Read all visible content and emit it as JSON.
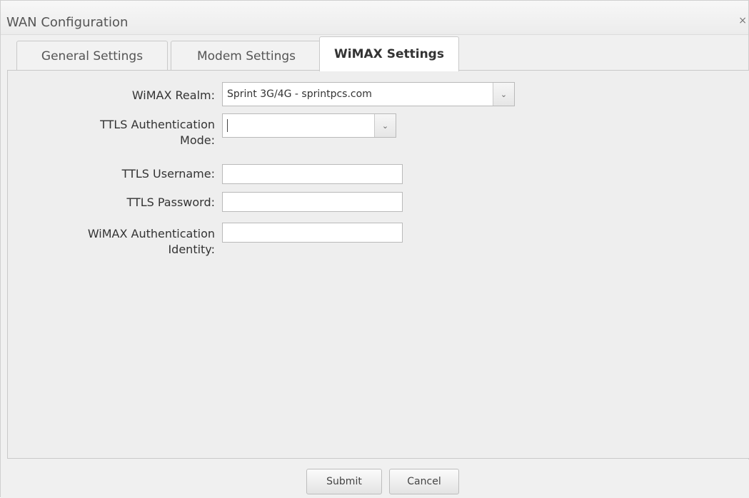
{
  "window": {
    "title": "WAN Configuration",
    "close_label": "×"
  },
  "tabs": [
    {
      "label": "General Settings",
      "active": false
    },
    {
      "label": "Modem Settings",
      "active": false
    },
    {
      "label": "WiMAX Settings",
      "active": true
    }
  ],
  "form": {
    "realm_label": "WiMAX Realm:",
    "realm_value": "Sprint 3G/4G - sprintpcs.com",
    "ttls_mode_label_line1": "TTLS Authentication",
    "ttls_mode_label_line2": "Mode:",
    "ttls_mode_value": "",
    "ttls_username_label": "TTLS Username:",
    "ttls_username_value": "",
    "ttls_password_label": "TTLS Password:",
    "ttls_password_value": "",
    "wimax_identity_label_line1": "WiMAX Authentication",
    "wimax_identity_label_line2": "Identity:",
    "wimax_identity_value": ""
  },
  "footer": {
    "submit_label": "Submit",
    "cancel_label": "Cancel"
  },
  "icons": {
    "dropdown": "chevron-down-icon",
    "close": "close-icon"
  }
}
